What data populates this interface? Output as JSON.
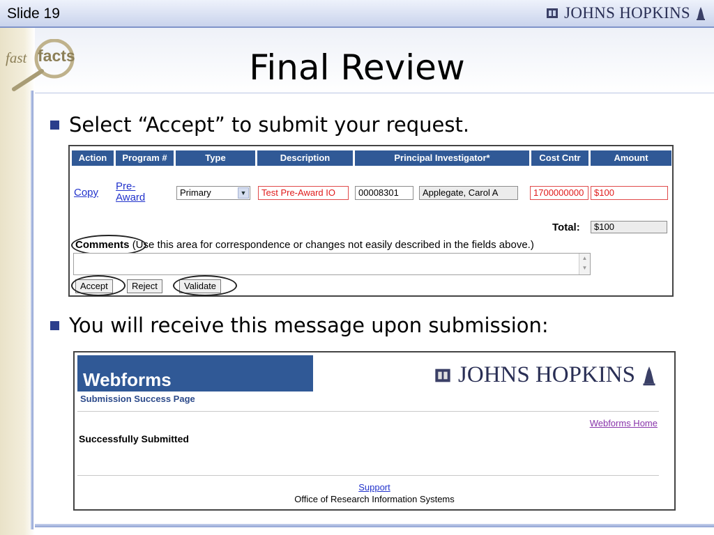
{
  "slide": {
    "number_label": "Slide 19",
    "brand": "JOHNS HOPKINS",
    "logo_text": {
      "part1": "fast",
      "part2": "facts"
    },
    "title": "Final Review"
  },
  "bullets": [
    "Select “Accept” to submit your request.",
    "You will receive this message upon submission:"
  ],
  "form": {
    "columns": [
      "Action",
      "Program #",
      "Type",
      "Description",
      "Principal Investigator*",
      "Cost Cntr",
      "Amount"
    ],
    "row": {
      "action_link": "Copy",
      "program_link_line1": "Pre-",
      "program_link_line2": "Award",
      "type_value": "Primary",
      "description": "Test Pre-Award IO",
      "pi_id": "00008301",
      "pi_name": "Applegate, Carol A",
      "cost_center": "1700000000",
      "amount": "$100"
    },
    "total_label": "Total:",
    "total_value": "$100",
    "comments_label": "Comments",
    "comments_hint": "(Use this area for correspondence or changes not easily described in the fields above.)",
    "buttons": {
      "accept": "Accept",
      "reject": "Reject",
      "validate": "Validate"
    }
  },
  "success_page": {
    "app_title": "Webforms",
    "subtitle": "Submission Success Page",
    "brand": "JOHNS HOPKINS",
    "home_link": "Webforms Home",
    "message": "Successfully Submitted",
    "support_link": "Support",
    "office": "Office of Research Information Systems"
  },
  "colors": {
    "header_blue": "#305996",
    "accent_line": "#7e93c9",
    "error_red": "#e01b1b"
  }
}
